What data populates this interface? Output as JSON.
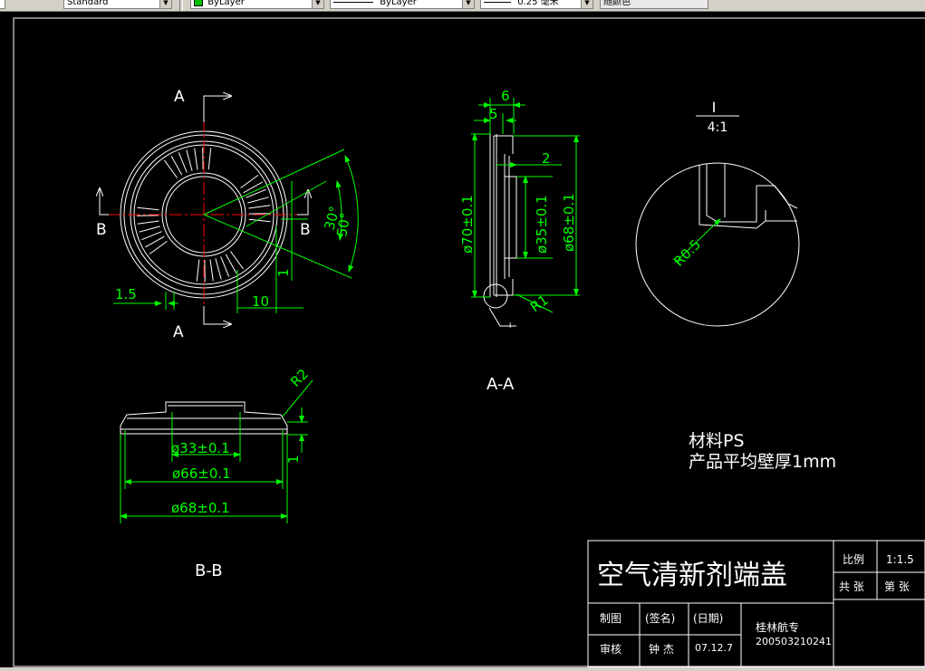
{
  "toolbar": {
    "textstyle_value": "Standard",
    "layer_value": "ByLayer",
    "linetype_value": "ByLayer",
    "lineweight_value": "0.25 毫米",
    "plotstyle_value": "随颜色"
  },
  "views": {
    "front_cut_top": "A",
    "front_cut_bottom": "A",
    "front_cut_left": "B",
    "front_cut_right": "B",
    "section_aa_title": "A-A",
    "section_bb_title": "B-B",
    "detail_label": "I",
    "detail_scale": "4:1"
  },
  "dimensions": {
    "front_1_5": "1.5",
    "front_10": "10",
    "front_1": "1",
    "front_30deg": "30°",
    "front_50deg": "50°",
    "aa_6": "6",
    "aa_5": "5",
    "aa_2": "2",
    "aa_d70": "ø70±0.1",
    "aa_d35": "ø35±0.1",
    "aa_d68": "ø68±0.1",
    "aa_r1": "R1",
    "aa_detail_ref": "I",
    "detail_r05": "R0.5",
    "bb_r2": "R2",
    "bb_d33": "ø33±0.1",
    "bb_d66": "ø66±0.1",
    "bb_d68": "ø68±0.1",
    "bb_1": "1"
  },
  "notes": {
    "material": "材料PS",
    "wall": "产品平均壁厚1mm"
  },
  "title_block": {
    "name": "空气清新剂端盖",
    "scale_label": "比例",
    "scale_value": "1:1.5",
    "total_label": "共 张",
    "sheet_label": "第 张",
    "drawn_label": "制图",
    "signature_label": "(签名)",
    "date_label": "(日期)",
    "check_label": "审核",
    "checker": "钟 杰",
    "date": "07.12.7",
    "school": "桂林航专",
    "student_id": "200503210241"
  },
  "colors": {
    "background": "#000000",
    "geometry": "#ffffff",
    "dimension": "#00ff00",
    "centerline": "#ff0000"
  }
}
